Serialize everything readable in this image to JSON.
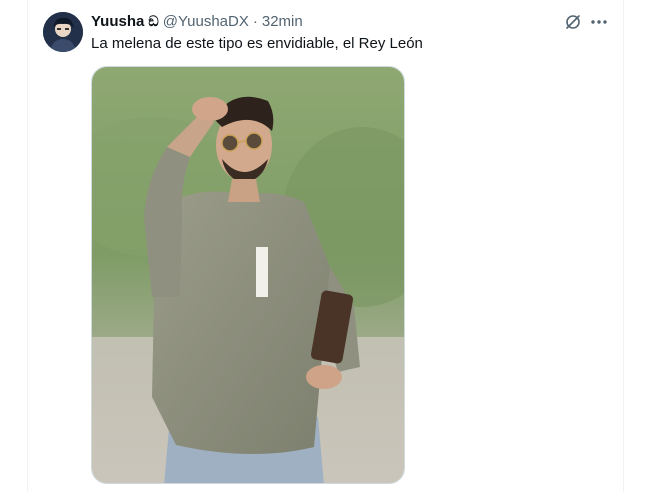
{
  "tweet": {
    "display_name": "Yuusha",
    "name_emoji": "ඞ",
    "handle": "@YuushaDX",
    "separator": "·",
    "time": "32min",
    "text": "La melena de este tipo es envidiable, el Rey León"
  },
  "icons": {
    "grok": "grok-icon",
    "more": "more-horizontal-icon"
  },
  "colors": {
    "text_primary": "#0f1419",
    "text_secondary": "#536471",
    "border": "#cfd9de"
  }
}
